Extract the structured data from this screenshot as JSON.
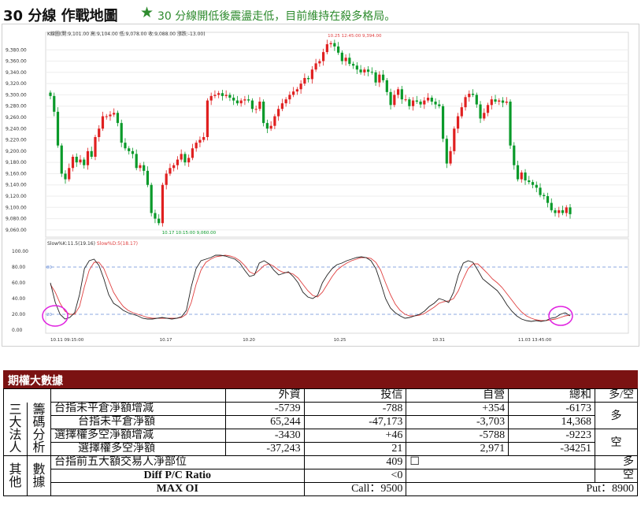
{
  "header": {
    "title": "30 分線 作戰地圖",
    "star": "★",
    "note": "30 分線開低後震盪走低，目前維持在殺多格局。"
  },
  "chart_data": [
    {
      "type": "candlestick",
      "info_label": "K線圖(開:9,101.00 高:9,104.00 低:9,078.00 收:9,088.00 漲跌:-13.00)",
      "ylim": [
        9050,
        9400
      ],
      "yticks": [
        "9,380.00",
        "9,360.00",
        "9,340.00",
        "9,320.00",
        "9,300.00",
        "9,280.00",
        "9,260.00",
        "9,240.00",
        "9,220.00",
        "9,200.00",
        "9,180.00",
        "9,160.00",
        "9,140.00",
        "9,120.00",
        "9,100.00",
        "9,080.00",
        "9,060.00"
      ],
      "x_labels": [
        "10.11 09:15:00",
        "10.17",
        "10.20",
        "10.25",
        "10.31",
        "11.03 13:45:00"
      ],
      "annotations": {
        "high": "10.25 12:45:00  9,394.00",
        "low": "10.17 10:15:00  9,060.00"
      },
      "close": [
        9298,
        9270,
        9210,
        9160,
        9150,
        9170,
        9190,
        9180,
        9185,
        9175,
        9200,
        9190,
        9225,
        9240,
        9262,
        9262,
        9265,
        9268,
        9250,
        9215,
        9205,
        9200,
        9195,
        9170,
        9175,
        9165,
        9140,
        9090,
        9080,
        9072,
        9140,
        9160,
        9170,
        9175,
        9185,
        9195,
        9180,
        9188,
        9205,
        9215,
        9220,
        9225,
        9290,
        9298,
        9300,
        9303,
        9298,
        9300,
        9295,
        9290,
        9285,
        9290,
        9292,
        9290,
        9275,
        9275,
        9288,
        9250,
        9240,
        9245,
        9262,
        9275,
        9285,
        9292,
        9300,
        9306,
        9310,
        9320,
        9330,
        9328,
        9345,
        9356,
        9360,
        9376,
        9390,
        9392,
        9386,
        9375,
        9360,
        9366,
        9355,
        9352,
        9345,
        9340,
        9345,
        9341,
        9340,
        9322,
        9336,
        9326,
        9305,
        9282,
        9300,
        9310,
        9292,
        9292,
        9280,
        9290,
        9288,
        9283,
        9290,
        9295,
        9288,
        9283,
        9280,
        9222,
        9178,
        9200,
        9240,
        9262,
        9278,
        9296,
        9302,
        9300,
        9283,
        9258,
        9268,
        9282,
        9292,
        9288,
        9290,
        9286,
        9288,
        9210,
        9175,
        9150,
        9162,
        9148,
        9145,
        9140,
        9135,
        9122,
        9120,
        9108,
        9095,
        9090,
        9095,
        9090,
        9100,
        9088
      ],
      "stoch_yticks": [
        "100.00",
        "80.00",
        "60.00",
        "40.00",
        "20.00",
        "0.00"
      ],
      "stoch_legend": {
        "k": "Slow%K:11.5(19.16)",
        "d": "Slow%D:5(18.17)"
      },
      "stoch_guides": [
        "80",
        "20"
      ],
      "slow_k": [
        60,
        35,
        20,
        14,
        16,
        22,
        45,
        78,
        88,
        90,
        82,
        65,
        45,
        34,
        30,
        25,
        22,
        20,
        18,
        15,
        14,
        14,
        15,
        16,
        15,
        14,
        15,
        17,
        25,
        55,
        78,
        88,
        90,
        92,
        95,
        95,
        94,
        92,
        90,
        85,
        76,
        68,
        70,
        85,
        88,
        84,
        76,
        70,
        72,
        74,
        68,
        60,
        48,
        42,
        40,
        44,
        60,
        70,
        78,
        83,
        85,
        88,
        90,
        92,
        93,
        92,
        88,
        78,
        60,
        40,
        28,
        22,
        18,
        15,
        16,
        18,
        20,
        24,
        30,
        34,
        40,
        38,
        35,
        48,
        70,
        85,
        88,
        86,
        76,
        65,
        60,
        55,
        50,
        42,
        32,
        24,
        18,
        14,
        12,
        11,
        12,
        11,
        12,
        15,
        16,
        20,
        22,
        18
      ],
      "slow_d": [
        58,
        48,
        34,
        24,
        20,
        20,
        30,
        55,
        76,
        86,
        86,
        78,
        63,
        48,
        38,
        30,
        25,
        22,
        20,
        18,
        16,
        15,
        15,
        15,
        15,
        15,
        15,
        16,
        20,
        35,
        58,
        76,
        86,
        90,
        93,
        94,
        95,
        94,
        92,
        88,
        82,
        74,
        71,
        76,
        82,
        84,
        81,
        76,
        73,
        73,
        71,
        66,
        58,
        50,
        44,
        42,
        48,
        58,
        68,
        76,
        81,
        85,
        88,
        90,
        92,
        92,
        91,
        86,
        76,
        60,
        45,
        33,
        25,
        20,
        18,
        18,
        19,
        21,
        25,
        29,
        34,
        36,
        37,
        40,
        50,
        65,
        78,
        84,
        84,
        78,
        72,
        65,
        60,
        54,
        46,
        38,
        30,
        23,
        18,
        15,
        13,
        12,
        12,
        13,
        14,
        16,
        18,
        19
      ]
    }
  ],
  "table": {
    "title": "期權大數據",
    "headers": {
      "foreign": "外資",
      "trust": "投信",
      "dealer": "自營",
      "total": "總和",
      "stance": "多/空"
    },
    "group1_label": [
      "三",
      "大",
      "法",
      "人"
    ],
    "group1_sub": [
      "籌",
      "碼",
      "分",
      "析"
    ],
    "rows": [
      {
        "label": "台指未平倉淨額增減",
        "foreign": "-5739",
        "trust": "-788",
        "dealer": "+354",
        "total": "-6173"
      },
      {
        "label": "台指未平倉淨額",
        "foreign": "65,244",
        "trust": "-47,173",
        "dealer": "-3,703",
        "total": "14,368"
      },
      {
        "label": "選擇權多空淨額增減",
        "foreign": "-3430",
        "trust": "+46",
        "dealer": "-5788",
        "total": "-9223"
      },
      {
        "label": "選擇權多空淨額",
        "foreign": "-37,243",
        "trust": "21",
        "dealer": "2,971",
        "total": "-34251"
      }
    ],
    "stance1": "多",
    "stance2": "空",
    "group2_label": [
      "其",
      "他"
    ],
    "group2_sub": [
      "數",
      "據"
    ],
    "other": {
      "top5_label": "台指前五大額交易人淨部位",
      "top5_value": "409",
      "top5_box": "☐",
      "top5_stance": "多",
      "pc_label": "Diff P/C Ratio",
      "pc_value": "<0",
      "pc_stance": "空",
      "maxoi_label": "MAX OI",
      "call": "Call：9500",
      "put": "Put：8900"
    }
  },
  "colors": {
    "up": "#e02020",
    "down": "#0a9a2a",
    "k_line": "#222222",
    "d_line": "#e04040",
    "guide": "#6a8fd8",
    "circle": "#e020e0",
    "header_bg": "#7b1212"
  }
}
